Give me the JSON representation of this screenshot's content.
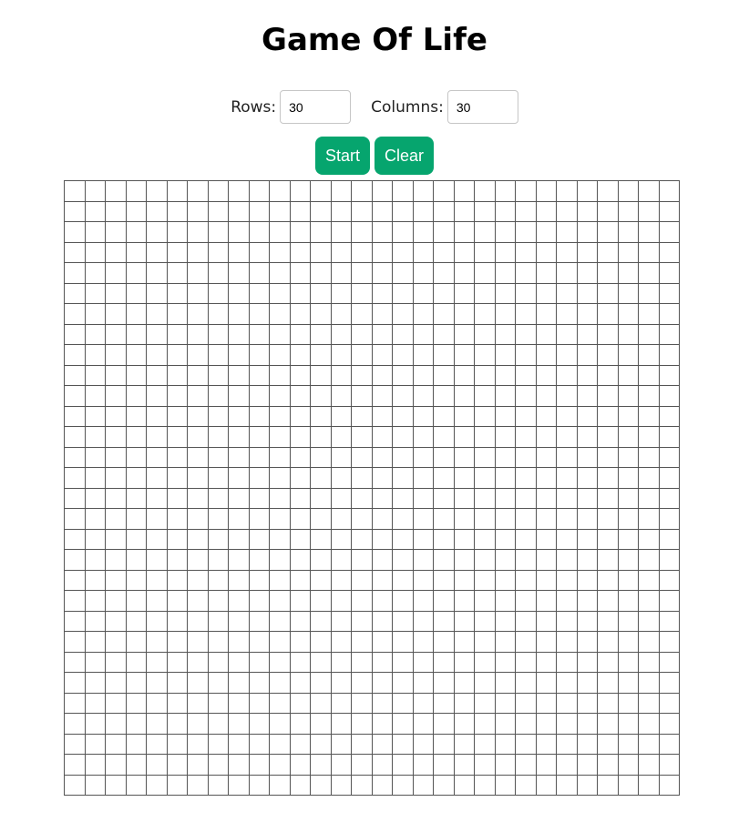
{
  "page": {
    "title": "Game Of Life"
  },
  "controls": {
    "rows_label": "Rows:",
    "rows_value": "30",
    "columns_label": "Columns:",
    "columns_value": "30"
  },
  "buttons": {
    "start_label": "Start",
    "clear_label": "Clear"
  },
  "grid": {
    "rows": 30,
    "columns": 30,
    "live_cells": []
  },
  "colors": {
    "button_background": "#06a56e",
    "button_text": "#ffffff",
    "grid_line": "#555555",
    "cell_dead": "#ffffff",
    "cell_alive": "#000000"
  }
}
